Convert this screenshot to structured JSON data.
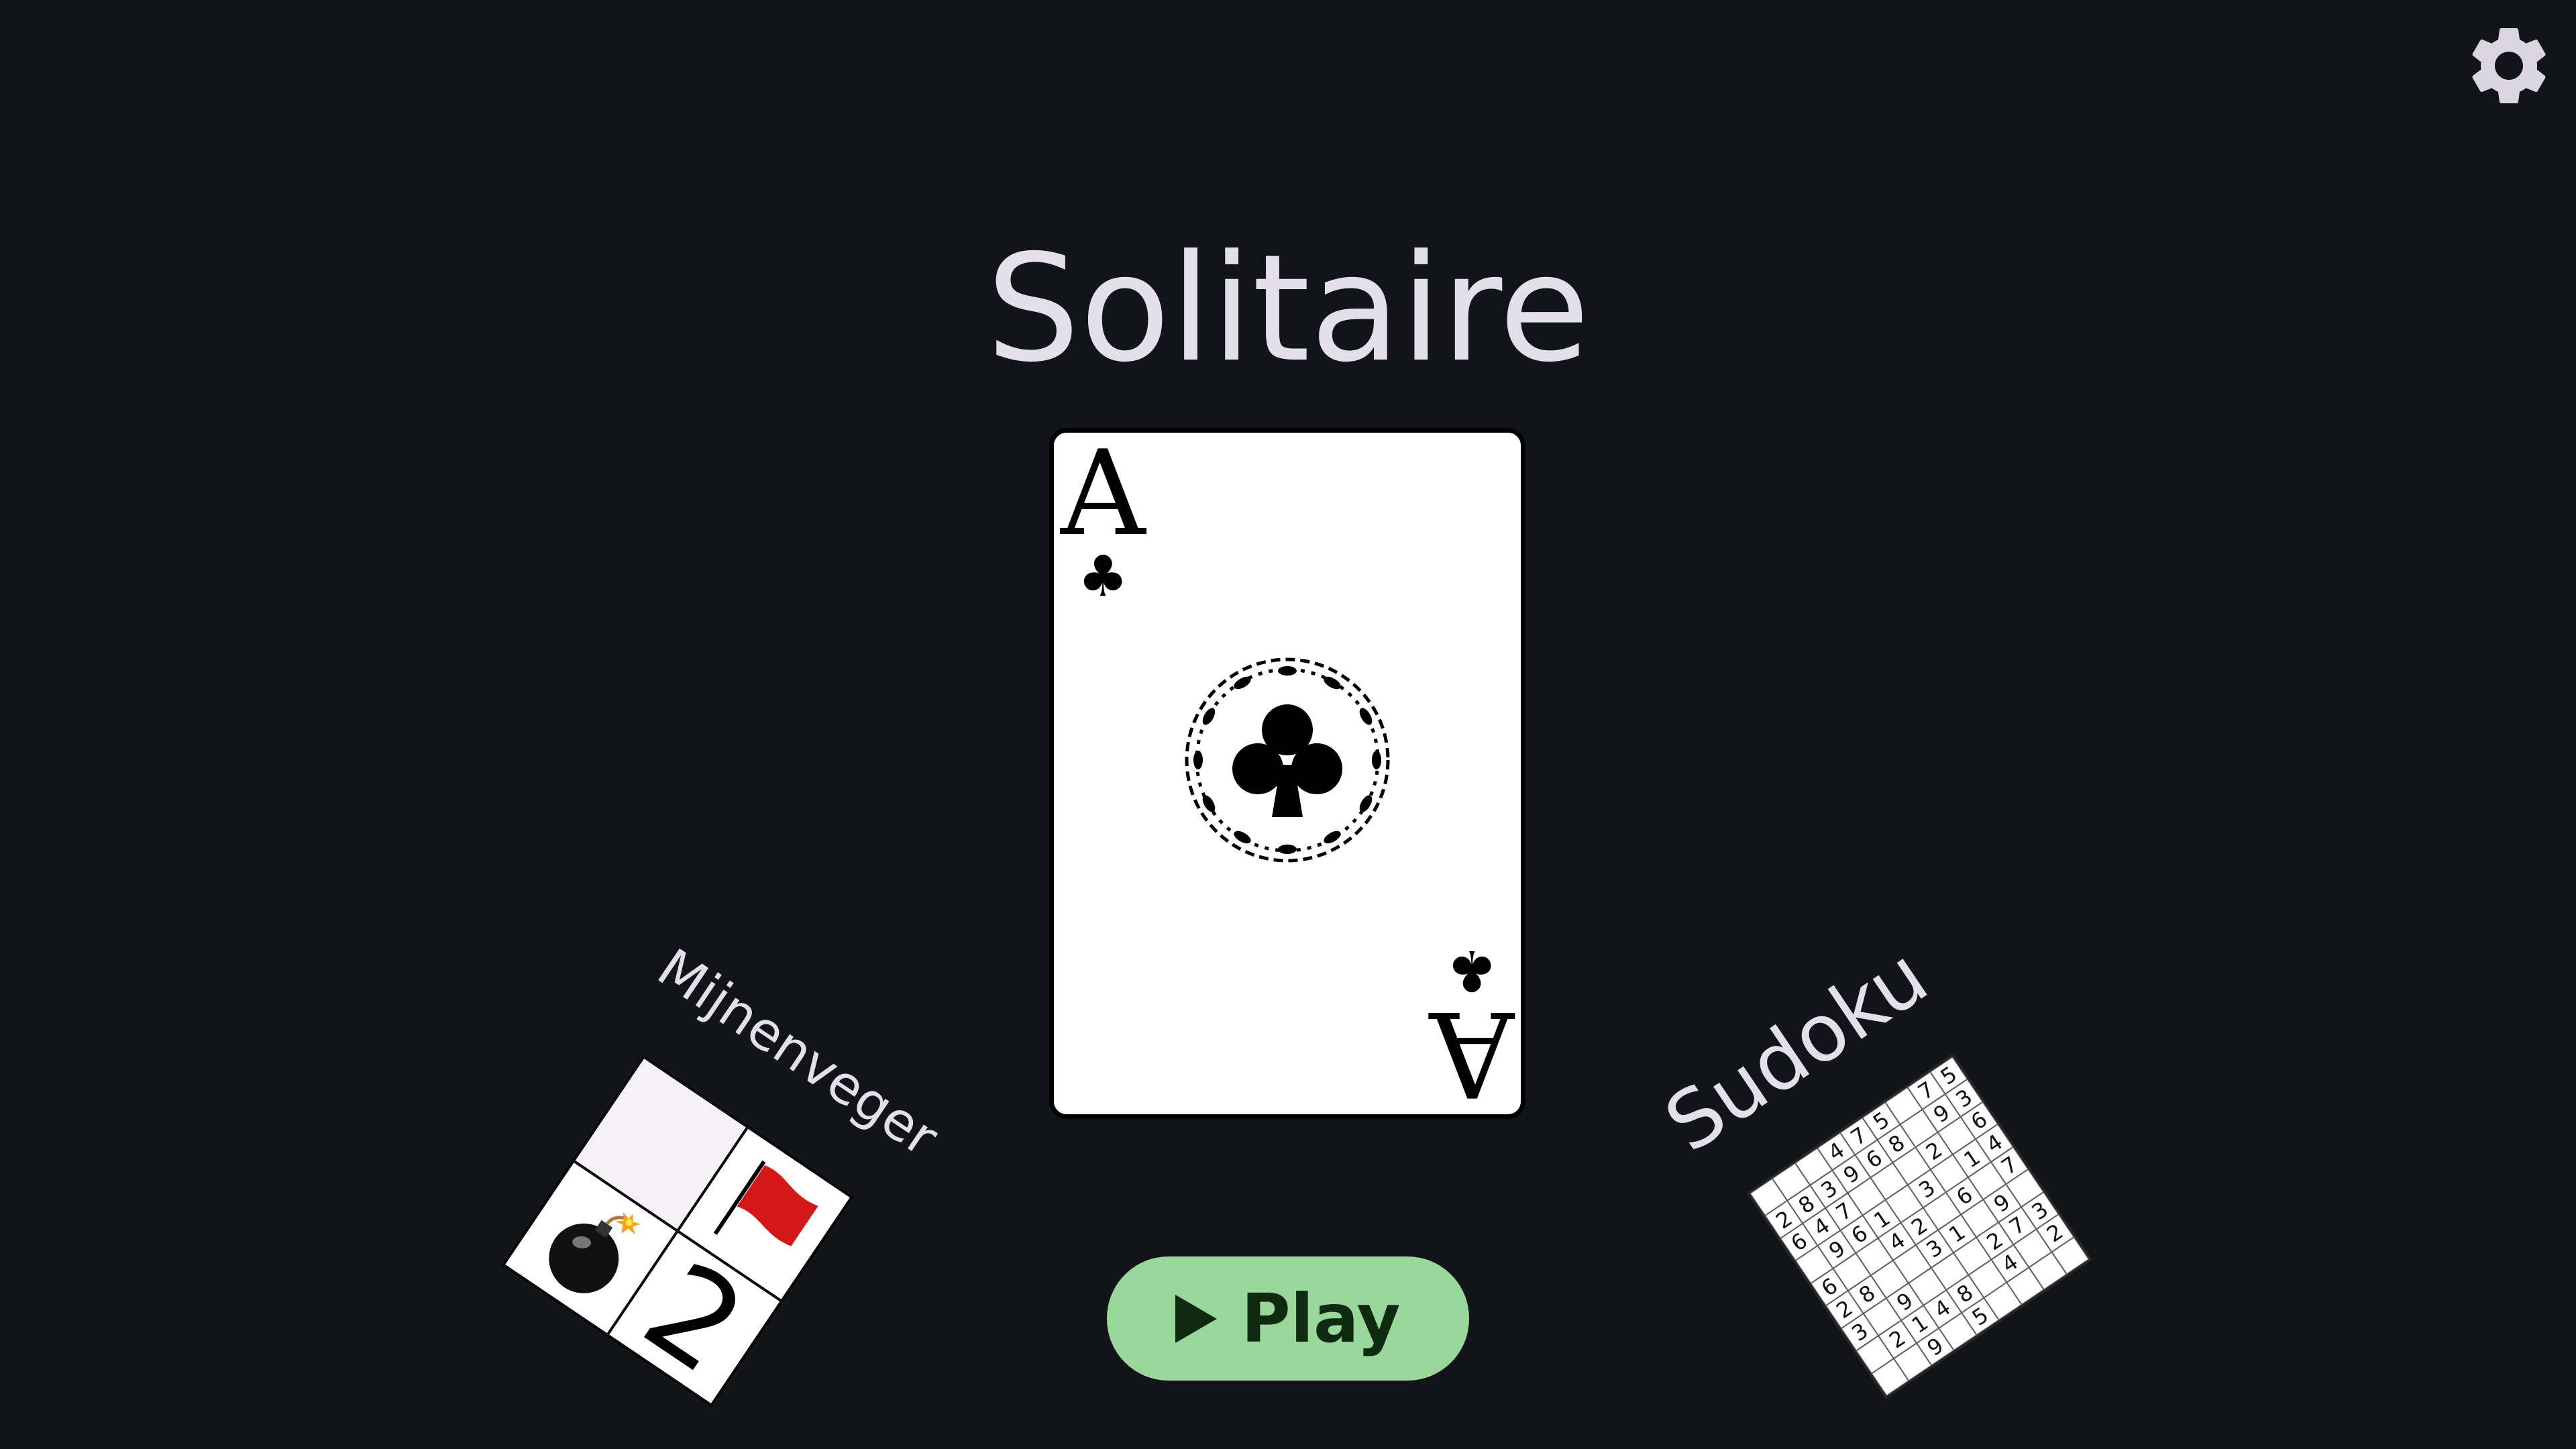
{
  "app": {
    "title": "Solitaire"
  },
  "header": {
    "settings_icon": "gear-icon"
  },
  "featured_card": {
    "rank": "A",
    "suit_symbol": "♣",
    "suit_name": "clubs"
  },
  "play_button": {
    "label": "Play",
    "icon": "play-icon",
    "color": "#99d79a"
  },
  "games": {
    "minesweeper": {
      "label": "Mijnenveger",
      "number": "2"
    },
    "sudoku": {
      "label": "Sudoku",
      "cells": [
        [
          "",
          "",
          "",
          "4",
          "7",
          "5",
          "",
          "7",
          "5"
        ],
        [
          "2",
          "8",
          "3",
          "9",
          "6",
          "8",
          "",
          "9",
          "3"
        ],
        [
          "6",
          "4",
          "7",
          "",
          "",
          "",
          "2",
          "",
          "6"
        ],
        [
          "",
          "9",
          "6",
          "1",
          "",
          "3",
          "",
          "1",
          "4"
        ],
        [
          "6",
          "",
          "",
          "4",
          "2",
          "",
          "6",
          "",
          "7"
        ],
        [
          "2",
          "8",
          "",
          "",
          "3",
          "1",
          "",
          "9",
          ""
        ],
        [
          "3",
          "",
          "9",
          "",
          "",
          "",
          "2",
          "7",
          "3"
        ],
        [
          "",
          "2",
          "1",
          "4",
          "8",
          "",
          "4",
          "",
          "2"
        ],
        [
          "",
          "",
          "9",
          "",
          "5",
          "",
          "",
          "",
          ""
        ]
      ]
    }
  },
  "colors": {
    "background": "#131419",
    "title_text": "#e3e0ec",
    "play_button": "#99d79a"
  }
}
